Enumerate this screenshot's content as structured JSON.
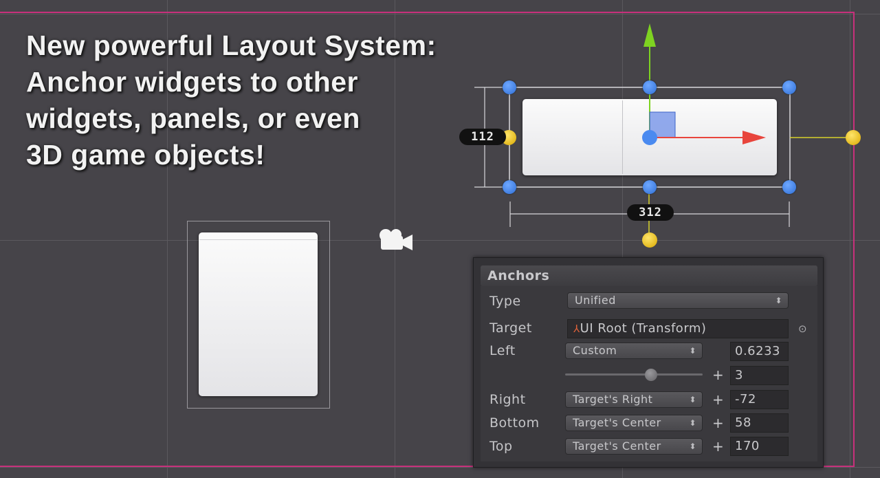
{
  "headline": {
    "line1": "New powerful Layout System:",
    "line2": "Anchor widgets to other",
    "line3": "widgets, panels, or even",
    "line4": "3D game objects!"
  },
  "scene": {
    "height_label": "112",
    "width_label": "312",
    "camera_icon": "camera-icon",
    "colors": {
      "background": "#464449",
      "bounds": "#c8307c",
      "y_axis": "#7ed321",
      "x_axis": "#e8453c",
      "handle": "#4a8af0",
      "anchor": "#f0c419"
    }
  },
  "anchors": {
    "title": "Anchors",
    "type_label": "Type",
    "type_value": "Unified",
    "target_label": "Target",
    "target_value": "UI Root (Transform)",
    "left_label": "Left",
    "left_mode": "Custom",
    "left_relative": "0.6233",
    "left_offset": "3",
    "left_slider": 0.6233,
    "right_label": "Right",
    "right_mode": "Target's Right",
    "right_offset": "-72",
    "bottom_label": "Bottom",
    "bottom_mode": "Target's Center",
    "bottom_offset": "58",
    "top_label": "Top",
    "top_mode": "Target's Center",
    "top_offset": "170",
    "plus": "+"
  }
}
